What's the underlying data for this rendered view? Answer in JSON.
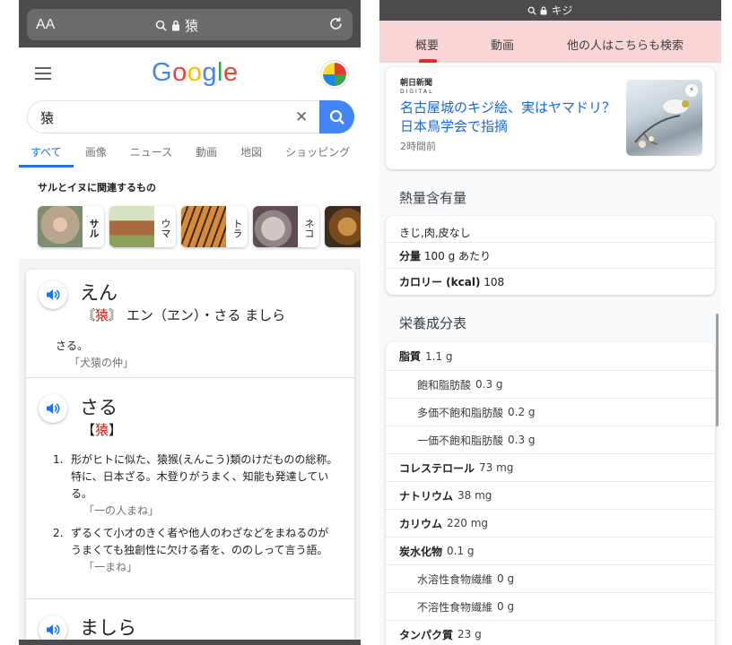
{
  "left": {
    "browser": {
      "aa_label": "AA",
      "url_text": "猿"
    },
    "google": {
      "logo_letters": [
        {
          "ch": "G",
          "color": "#4285F4"
        },
        {
          "ch": "o",
          "color": "#EA4335"
        },
        {
          "ch": "o",
          "color": "#FBBC05"
        },
        {
          "ch": "g",
          "color": "#4285F4"
        },
        {
          "ch": "l",
          "color": "#34A853"
        },
        {
          "ch": "e",
          "color": "#EA4335"
        }
      ],
      "search_value": "猿",
      "clear_symbol": "✕",
      "tabs": [
        "すべて",
        "画像",
        "ニュース",
        "動画",
        "地図",
        "ショッピング"
      ],
      "related_title": "サルとイヌに関連するもの",
      "related_chips": [
        {
          "label": "サル",
          "selected": true
        },
        {
          "label": "ウマ",
          "selected": false
        },
        {
          "label": "トラ",
          "selected": false
        },
        {
          "label": "ネコ",
          "selected": false
        }
      ]
    },
    "dictionary": {
      "entry1": {
        "kana": "えん",
        "bracket_open": "〘",
        "kanji": "猿",
        "bracket_close": "〙",
        "readings": "エン（ヱン）・さる ましら",
        "definition": "さる。",
        "example": "「犬猿の仲」"
      },
      "entry2": {
        "kana": "さる",
        "bracket_open": "【",
        "kanji": "猿",
        "bracket_close": "】",
        "definitions": [
          {
            "num": "1.",
            "text": "形がヒトに似た、猿猴(えんこう)類のけだものの総称。特に、日本ざる。木登りがうまく、知能も発達している。",
            "example": "「一の人まね」"
          },
          {
            "num": "2.",
            "text": "ずるくて小才のきく者や他人のわざなどをまねるのがうまくても独創性に欠ける者を、ののしって言う語。",
            "example": "「一まね」"
          }
        ]
      },
      "entry3": {
        "kana": "ましら"
      }
    }
  },
  "right": {
    "status_title": "キジ",
    "tabs": [
      "概要",
      "動画",
      "他の人はこちらも検索"
    ],
    "news": {
      "source_line1": "朝日新聞",
      "source_line2": "DIGITAL",
      "title": "名古屋城のキジ絵、実はヤマドリ？日本鳥学会で指摘",
      "time": "2時間前"
    },
    "calorie_section": {
      "title": "熱量含有量",
      "item": "きじ,肉,皮なし",
      "serving_label": "分量",
      "serving_value": "100 g あたり",
      "calorie_label": "カロリー (kcal)",
      "calorie_value": "108"
    },
    "nutrition_section": {
      "title": "栄養成分表",
      "rows": [
        {
          "label": "脂質",
          "value": "1.1 g",
          "sub": false
        },
        {
          "label": "飽和脂肪酸",
          "value": "0.3 g",
          "sub": true
        },
        {
          "label": "多価不飽和脂肪酸",
          "value": "0.2 g",
          "sub": true
        },
        {
          "label": "一価不飽和脂肪酸",
          "value": "0.3 g",
          "sub": true
        },
        {
          "label": "コレステロール",
          "value": "73 mg",
          "sub": false
        },
        {
          "label": "ナトリウム",
          "value": "38 mg",
          "sub": false
        },
        {
          "label": "カリウム",
          "value": "220 mg",
          "sub": false
        },
        {
          "label": "炭水化物",
          "value": "0.1 g",
          "sub": false
        },
        {
          "label": "水溶性食物繊維",
          "value": "0 g",
          "sub": true
        },
        {
          "label": "不溶性食物繊維",
          "value": "0 g",
          "sub": true
        },
        {
          "label": "タンパク質",
          "value": "23 g",
          "sub": false
        }
      ]
    }
  }
}
